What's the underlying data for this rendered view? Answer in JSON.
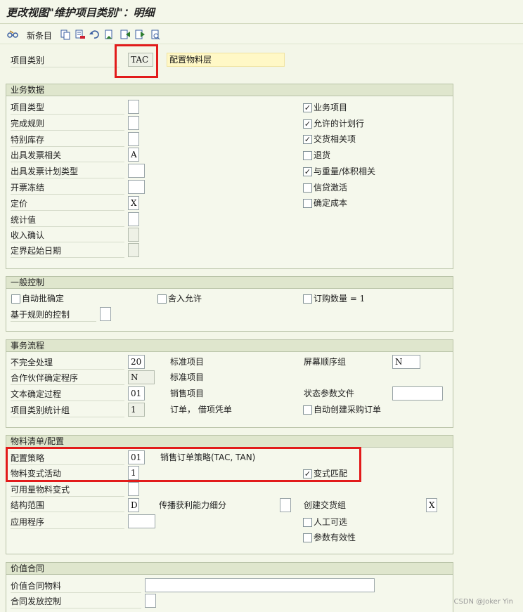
{
  "title": "更改视图\"维护项目类别\"：明细",
  "toolbar": {
    "new_entries_label": "新条目",
    "icons": [
      "glasses-icon",
      "copy-icon",
      "delete-icon",
      "undo-icon",
      "select-all-icon",
      "previous-icon",
      "next-icon",
      "more-icon",
      "print-icon"
    ]
  },
  "item_category": {
    "label": "项目类别",
    "value": "TAC",
    "description": "配置物料层"
  },
  "business_data": {
    "title": "业务数据",
    "fields": [
      {
        "label": "项目类型",
        "value": ""
      },
      {
        "label": "完成规则",
        "value": ""
      },
      {
        "label": "特别库存",
        "value": ""
      },
      {
        "label": "出具发票相关",
        "value": "A"
      },
      {
        "label": "出具发票计划类型",
        "value": ""
      },
      {
        "label": "开票冻结",
        "value": ""
      },
      {
        "label": "定价",
        "value": "X"
      },
      {
        "label": "统计值",
        "value": ""
      },
      {
        "label": "收入确认",
        "value": ""
      },
      {
        "label": "定界起始日期",
        "value": ""
      }
    ],
    "checkboxes": [
      {
        "label": "业务项目",
        "checked": true
      },
      {
        "label": "允许的计划行",
        "checked": true
      },
      {
        "label": "交货相关项",
        "checked": true
      },
      {
        "label": "退货",
        "checked": false
      },
      {
        "label": "与重量/体积相关",
        "checked": true
      },
      {
        "label": "信贷激活",
        "checked": false
      },
      {
        "label": "确定成本",
        "checked": false
      }
    ]
  },
  "general_control": {
    "title": "一般控制",
    "auto_batch_label": "自动批确定",
    "rounding_label": "舍入允许",
    "order_qty_label": "订购数量 = 1",
    "rule_control_label": "基于规则的控制",
    "rule_control_value": ""
  },
  "transaction_flow": {
    "title": "事务流程",
    "incompletion_label": "不完全处理",
    "incompletion_value": "20",
    "incompletion_desc": "标准项目",
    "partner_label": "合作伙伴确定程序",
    "partner_value": "N",
    "partner_desc": "标准项目",
    "text_label": "文本确定过程",
    "text_value": "01",
    "text_desc": "销售项目",
    "stat_label": "项目类别统计组",
    "stat_value": "1",
    "stat_desc": "订单， 借项凭单",
    "screen_seq_label": "屏幕顺序组",
    "screen_seq_value": "N",
    "status_profile_label": "状态参数文件",
    "status_profile_value": "",
    "auto_po_label": "自动创建采购订单"
  },
  "bom_config": {
    "title": "物料清单/配置",
    "strategy_label": "配置策略",
    "strategy_value": "01",
    "strategy_desc": "销售订单策略(TAC, TAN)",
    "variant_label": "物料变式活动",
    "variant_value": "1",
    "variant_match_label": "变式匹配",
    "atp_variant_label": "可用量物料变式",
    "atp_variant_value": "",
    "structure_label": "结构范围",
    "structure_value": "D",
    "profit_label": "传播获利能力细分",
    "profit_value": "",
    "delivery_group_label": "创建交货组",
    "delivery_group_value": "X",
    "application_label": "应用程序",
    "application_value": "",
    "manual_alt_label": "人工可选",
    "param_eff_label": "参数有效性"
  },
  "value_contract": {
    "title": "价值合同",
    "material_label": "价值合同物料",
    "material_value": "",
    "release_label": "合同发放控制",
    "release_value": ""
  },
  "watermark": "CSDN @Joker Yin",
  "colors": {
    "highlight": "#e21b1b",
    "header": "#dfe6cd",
    "background": "#f3f6e8"
  }
}
